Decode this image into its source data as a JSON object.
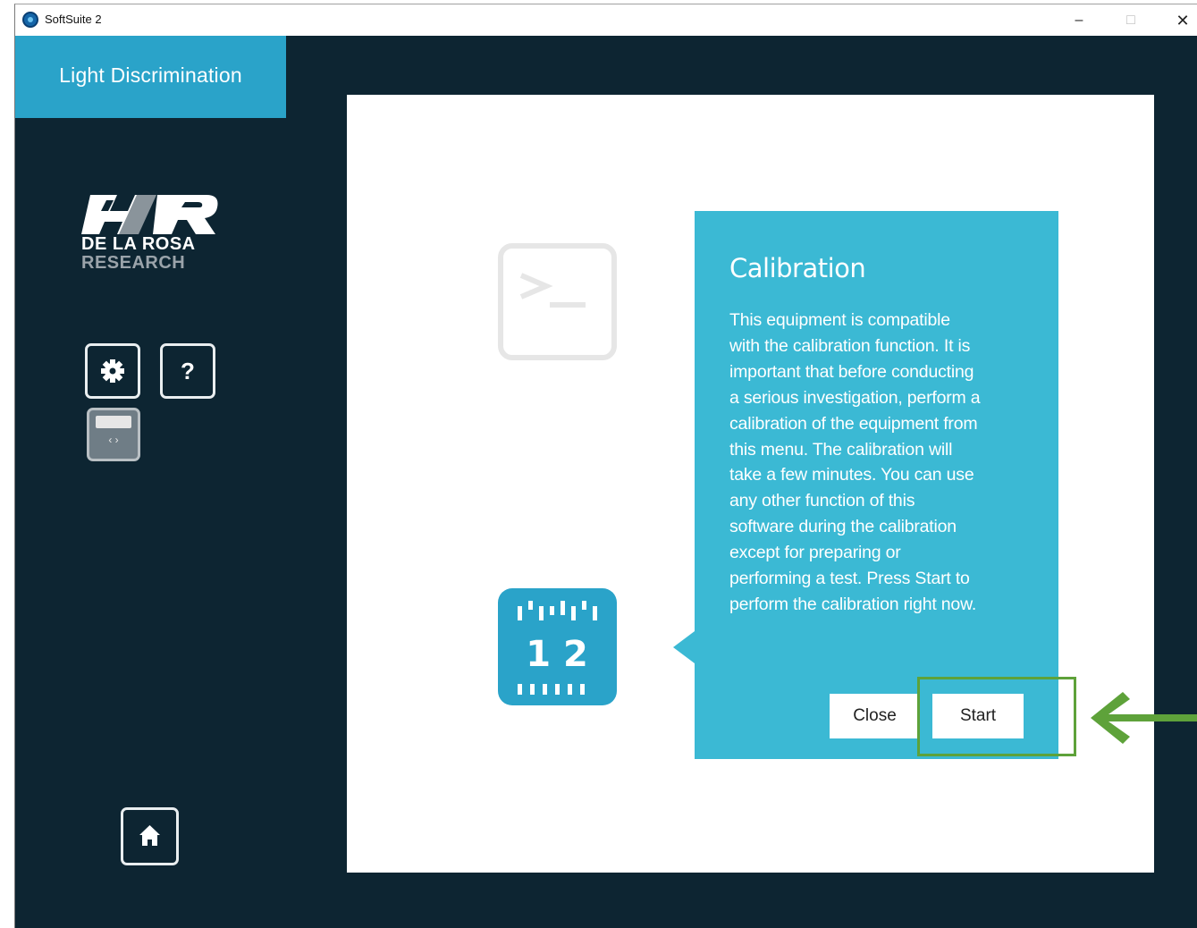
{
  "window": {
    "title": "SoftSuite 2",
    "controls": {
      "minimize": "–",
      "maximize": "□",
      "close": "✕"
    }
  },
  "sidebar": {
    "title": "Light Discrimination",
    "logo": {
      "line1": "DE LA ROSA",
      "line2": "RESEARCH"
    },
    "buttons": {
      "settings_icon": "gear-icon",
      "help_label": "?",
      "display_icon": "display-icon",
      "home_icon": "home-icon"
    }
  },
  "main": {
    "popover": {
      "title": "Calibration",
      "body_lines": [
        "This equipment is compatible",
        "with the calibration function. It is",
        "important that before conducting",
        "a serious investigation, perform a",
        "calibration of the equipment from",
        "this menu. The calibration will",
        "take a few minutes. You can use",
        "any other function of this",
        "software during the calibration",
        "except for preparing or",
        "performing a test. Press Start to",
        "perform the calibration right now."
      ],
      "close_label": "Close",
      "start_label": "Start"
    },
    "icons": {
      "terminal": "terminal-icon",
      "calibration": "calibration-ruler-icon",
      "calibration_digits": "1 2"
    }
  },
  "annotation": {
    "color": "#5ea23a"
  },
  "colors": {
    "accent": "#2aa3c9",
    "popover": "#3bb9d4",
    "background": "#0d2532"
  }
}
